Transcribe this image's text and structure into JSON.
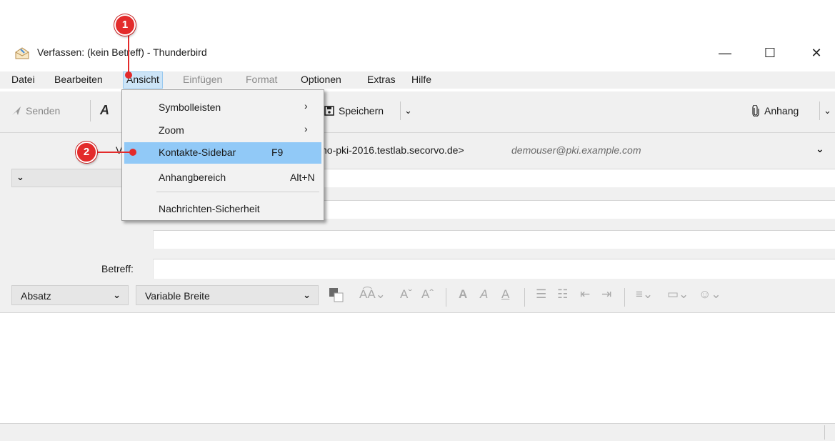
{
  "window": {
    "title": "Verfassen: (kein Betreff) - Thunderbird",
    "minimize_glyph": "—",
    "maximize_glyph": "☐",
    "close_glyph": "✕"
  },
  "menubar": {
    "items": [
      {
        "label": "Datei",
        "state": "normal"
      },
      {
        "label": "Bearbeiten",
        "state": "normal"
      },
      {
        "label": "Ansicht",
        "state": "active"
      },
      {
        "label": "Einfügen",
        "state": "disabled"
      },
      {
        "label": "Format",
        "state": "disabled"
      },
      {
        "label": "Optionen",
        "state": "normal"
      },
      {
        "label": "Extras",
        "state": "normal"
      },
      {
        "label": "Hilfe",
        "state": "normal"
      }
    ]
  },
  "toolbar": {
    "send_label": "Senden",
    "save_label": "Speichern",
    "attach_label": "Anhang"
  },
  "headers": {
    "from_partial": "V",
    "from_identity": "no-pki-2016.testlab.secorvo.de>",
    "from_email": "demouser@pki.example.com",
    "subject_label": "Betreff:"
  },
  "format_bar": {
    "paragraph_select": "Absatz",
    "font_select": "Variable Breite"
  },
  "dropdown_menu": {
    "items": [
      {
        "label": "Symbolleisten",
        "accel": "",
        "submenu": true
      },
      {
        "label": "Zoom",
        "accel": "",
        "submenu": true
      },
      {
        "label": "Kontakte-Sidebar",
        "accel": "F9",
        "submenu": false,
        "highlighted": true
      },
      {
        "label": "Anhangbereich",
        "accel": "Alt+N",
        "submenu": false
      },
      {
        "label": "Nachrichten-Sicherheit",
        "accel": "",
        "submenu": false
      }
    ]
  },
  "callouts": [
    "1",
    "2"
  ],
  "colors": {
    "callout_red": "#e32b2b",
    "menu_highlight": "#91c9f7",
    "chrome_gray": "#f0f0f0"
  }
}
